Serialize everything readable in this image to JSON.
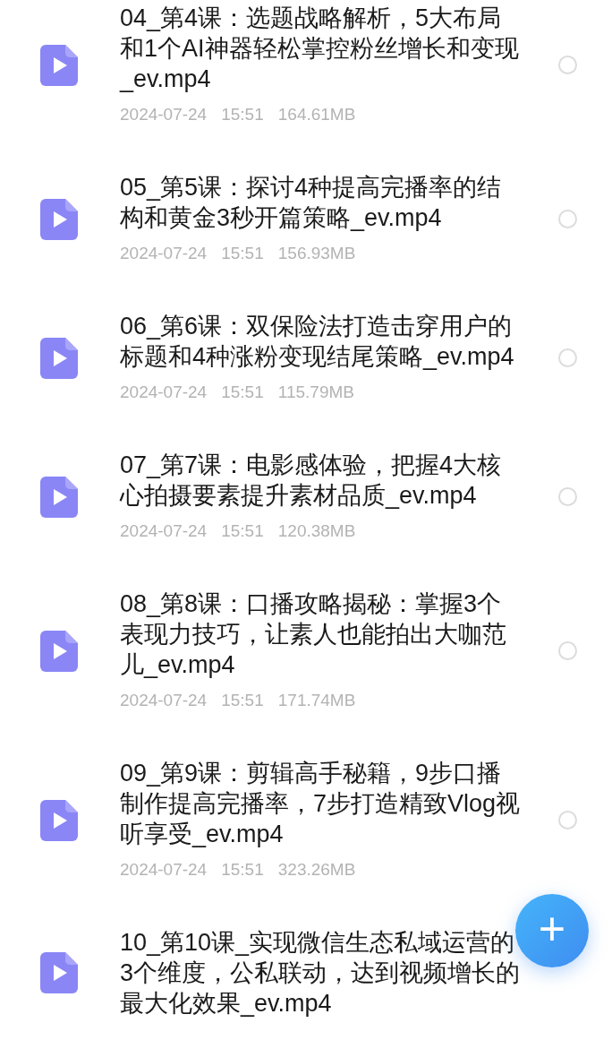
{
  "files": [
    {
      "name": "04_第4课：选题战略解析，5大布局和1个AI神器轻松掌控粉丝增长和变现_ev.mp4",
      "date": "2024-07-24",
      "time": "15:51",
      "size": "164.61MB",
      "selected": false
    },
    {
      "name": "05_第5课：探讨4种提高完播率的结构和黄金3秒开篇策略_ev.mp4",
      "date": "2024-07-24",
      "time": "15:51",
      "size": "156.93MB",
      "selected": false
    },
    {
      "name": "06_第6课：双保险法打造击穿用户的标题和4种涨粉变现结尾策略_ev.mp4",
      "date": "2024-07-24",
      "time": "15:51",
      "size": "115.79MB",
      "selected": false
    },
    {
      "name": "07_第7课：电影感体验，把握4大核心拍摄要素提升素材品质_ev.mp4",
      "date": "2024-07-24",
      "time": "15:51",
      "size": "120.38MB",
      "selected": false
    },
    {
      "name": "08_第8课：口播攻略揭秘：掌握3个表现力技巧，让素人也能拍出大咖范儿_ev.mp4",
      "date": "2024-07-24",
      "time": "15:51",
      "size": "171.74MB",
      "selected": false
    },
    {
      "name": "09_第9课：剪辑高手秘籍，9步口播制作提高完播率，7步打造精致Vlog视听享受_ev.mp4",
      "date": "2024-07-24",
      "time": "15:51",
      "size": "323.26MB",
      "selected": false
    },
    {
      "name": "10_第10课_实现微信生态私域运营的3个维度，公私联动，达到视频增长的最大化效果_ev.mp4"
    }
  ],
  "fab": {
    "label": "+"
  }
}
